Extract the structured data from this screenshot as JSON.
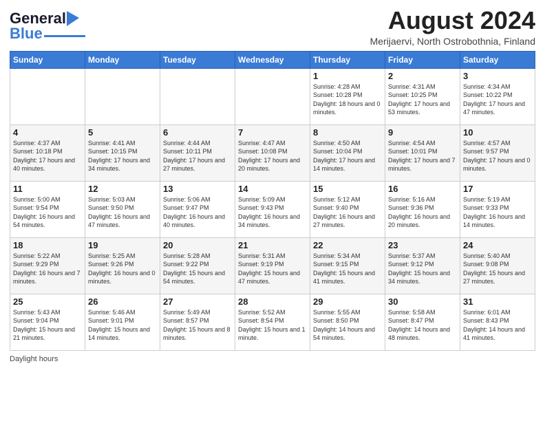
{
  "header": {
    "logo_line1": "General",
    "logo_line2": "Blue",
    "month_title": "August 2024",
    "location": "Merijaervi, North Ostrobothnia, Finland"
  },
  "days_of_week": [
    "Sunday",
    "Monday",
    "Tuesday",
    "Wednesday",
    "Thursday",
    "Friday",
    "Saturday"
  ],
  "weeks": [
    [
      {
        "day": "",
        "sunrise": "",
        "sunset": "",
        "daylight": ""
      },
      {
        "day": "",
        "sunrise": "",
        "sunset": "",
        "daylight": ""
      },
      {
        "day": "",
        "sunrise": "",
        "sunset": "",
        "daylight": ""
      },
      {
        "day": "",
        "sunrise": "",
        "sunset": "",
        "daylight": ""
      },
      {
        "day": "1",
        "sunrise": "Sunrise: 4:28 AM",
        "sunset": "Sunset: 10:28 PM",
        "daylight": "Daylight: 18 hours and 0 minutes."
      },
      {
        "day": "2",
        "sunrise": "Sunrise: 4:31 AM",
        "sunset": "Sunset: 10:25 PM",
        "daylight": "Daylight: 17 hours and 53 minutes."
      },
      {
        "day": "3",
        "sunrise": "Sunrise: 4:34 AM",
        "sunset": "Sunset: 10:22 PM",
        "daylight": "Daylight: 17 hours and 47 minutes."
      }
    ],
    [
      {
        "day": "4",
        "sunrise": "Sunrise: 4:37 AM",
        "sunset": "Sunset: 10:18 PM",
        "daylight": "Daylight: 17 hours and 40 minutes."
      },
      {
        "day": "5",
        "sunrise": "Sunrise: 4:41 AM",
        "sunset": "Sunset: 10:15 PM",
        "daylight": "Daylight: 17 hours and 34 minutes."
      },
      {
        "day": "6",
        "sunrise": "Sunrise: 4:44 AM",
        "sunset": "Sunset: 10:11 PM",
        "daylight": "Daylight: 17 hours and 27 minutes."
      },
      {
        "day": "7",
        "sunrise": "Sunrise: 4:47 AM",
        "sunset": "Sunset: 10:08 PM",
        "daylight": "Daylight: 17 hours and 20 minutes."
      },
      {
        "day": "8",
        "sunrise": "Sunrise: 4:50 AM",
        "sunset": "Sunset: 10:04 PM",
        "daylight": "Daylight: 17 hours and 14 minutes."
      },
      {
        "day": "9",
        "sunrise": "Sunrise: 4:54 AM",
        "sunset": "Sunset: 10:01 PM",
        "daylight": "Daylight: 17 hours and 7 minutes."
      },
      {
        "day": "10",
        "sunrise": "Sunrise: 4:57 AM",
        "sunset": "Sunset: 9:57 PM",
        "daylight": "Daylight: 17 hours and 0 minutes."
      }
    ],
    [
      {
        "day": "11",
        "sunrise": "Sunrise: 5:00 AM",
        "sunset": "Sunset: 9:54 PM",
        "daylight": "Daylight: 16 hours and 54 minutes."
      },
      {
        "day": "12",
        "sunrise": "Sunrise: 5:03 AM",
        "sunset": "Sunset: 9:50 PM",
        "daylight": "Daylight: 16 hours and 47 minutes."
      },
      {
        "day": "13",
        "sunrise": "Sunrise: 5:06 AM",
        "sunset": "Sunset: 9:47 PM",
        "daylight": "Daylight: 16 hours and 40 minutes."
      },
      {
        "day": "14",
        "sunrise": "Sunrise: 5:09 AM",
        "sunset": "Sunset: 9:43 PM",
        "daylight": "Daylight: 16 hours and 34 minutes."
      },
      {
        "day": "15",
        "sunrise": "Sunrise: 5:12 AM",
        "sunset": "Sunset: 9:40 PM",
        "daylight": "Daylight: 16 hours and 27 minutes."
      },
      {
        "day": "16",
        "sunrise": "Sunrise: 5:16 AM",
        "sunset": "Sunset: 9:36 PM",
        "daylight": "Daylight: 16 hours and 20 minutes."
      },
      {
        "day": "17",
        "sunrise": "Sunrise: 5:19 AM",
        "sunset": "Sunset: 9:33 PM",
        "daylight": "Daylight: 16 hours and 14 minutes."
      }
    ],
    [
      {
        "day": "18",
        "sunrise": "Sunrise: 5:22 AM",
        "sunset": "Sunset: 9:29 PM",
        "daylight": "Daylight: 16 hours and 7 minutes."
      },
      {
        "day": "19",
        "sunrise": "Sunrise: 5:25 AM",
        "sunset": "Sunset: 9:26 PM",
        "daylight": "Daylight: 16 hours and 0 minutes."
      },
      {
        "day": "20",
        "sunrise": "Sunrise: 5:28 AM",
        "sunset": "Sunset: 9:22 PM",
        "daylight": "Daylight: 15 hours and 54 minutes."
      },
      {
        "day": "21",
        "sunrise": "Sunrise: 5:31 AM",
        "sunset": "Sunset: 9:19 PM",
        "daylight": "Daylight: 15 hours and 47 minutes."
      },
      {
        "day": "22",
        "sunrise": "Sunrise: 5:34 AM",
        "sunset": "Sunset: 9:15 PM",
        "daylight": "Daylight: 15 hours and 41 minutes."
      },
      {
        "day": "23",
        "sunrise": "Sunrise: 5:37 AM",
        "sunset": "Sunset: 9:12 PM",
        "daylight": "Daylight: 15 hours and 34 minutes."
      },
      {
        "day": "24",
        "sunrise": "Sunrise: 5:40 AM",
        "sunset": "Sunset: 9:08 PM",
        "daylight": "Daylight: 15 hours and 27 minutes."
      }
    ],
    [
      {
        "day": "25",
        "sunrise": "Sunrise: 5:43 AM",
        "sunset": "Sunset: 9:04 PM",
        "daylight": "Daylight: 15 hours and 21 minutes."
      },
      {
        "day": "26",
        "sunrise": "Sunrise: 5:46 AM",
        "sunset": "Sunset: 9:01 PM",
        "daylight": "Daylight: 15 hours and 14 minutes."
      },
      {
        "day": "27",
        "sunrise": "Sunrise: 5:49 AM",
        "sunset": "Sunset: 8:57 PM",
        "daylight": "Daylight: 15 hours and 8 minutes."
      },
      {
        "day": "28",
        "sunrise": "Sunrise: 5:52 AM",
        "sunset": "Sunset: 8:54 PM",
        "daylight": "Daylight: 15 hours and 1 minute."
      },
      {
        "day": "29",
        "sunrise": "Sunrise: 5:55 AM",
        "sunset": "Sunset: 8:50 PM",
        "daylight": "Daylight: 14 hours and 54 minutes."
      },
      {
        "day": "30",
        "sunrise": "Sunrise: 5:58 AM",
        "sunset": "Sunset: 8:47 PM",
        "daylight": "Daylight: 14 hours and 48 minutes."
      },
      {
        "day": "31",
        "sunrise": "Sunrise: 6:01 AM",
        "sunset": "Sunset: 8:43 PM",
        "daylight": "Daylight: 14 hours and 41 minutes."
      }
    ]
  ],
  "footer": {
    "daylight_label": "Daylight hours"
  }
}
